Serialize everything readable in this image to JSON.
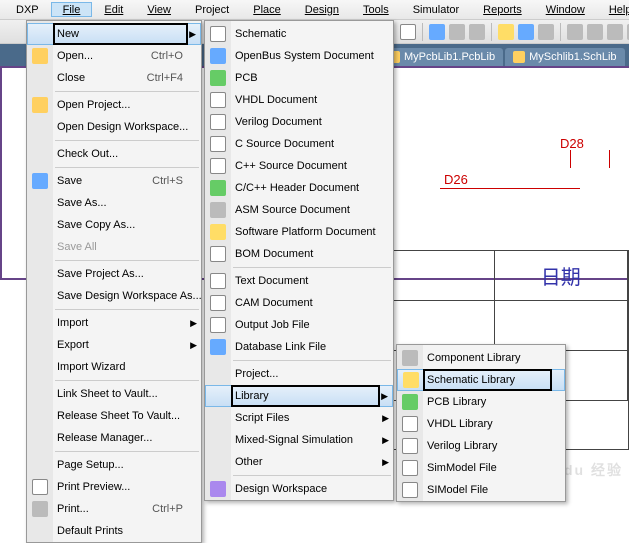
{
  "menubar": {
    "file": "File",
    "dxp": "DXP",
    "edit": "Edit",
    "view": "View",
    "project": "Project",
    "place": "Place",
    "design": "Design",
    "tools": "Tools",
    "simulator": "Simulator",
    "reports": "Reports",
    "window": "Window",
    "help": "Help"
  },
  "tabs": {
    "t1": "MyPcbLib1.PcbLib",
    "t2": "MySchlib1.SchLib"
  },
  "canvas": {
    "d28": "D28",
    "d26": "D26",
    "bigcell": "日期"
  },
  "file_menu": {
    "new": "New",
    "open": "Open...",
    "open_sc": "Ctrl+O",
    "close": "Close",
    "close_sc": "Ctrl+F4",
    "open_project": "Open Project...",
    "open_workspace": "Open Design Workspace...",
    "check_out": "Check Out...",
    "save": "Save",
    "save_sc": "Ctrl+S",
    "save_as": "Save As...",
    "save_copy": "Save Copy As...",
    "save_all": "Save All",
    "save_project_as": "Save Project As...",
    "save_workspace_as": "Save Design Workspace As...",
    "import": "Import",
    "export": "Export",
    "import_wizard": "Import Wizard",
    "link_vault": "Link Sheet to Vault...",
    "release_vault": "Release Sheet To Vault...",
    "release_manager": "Release Manager...",
    "page_setup": "Page Setup...",
    "print_preview": "Print Preview...",
    "print": "Print...",
    "print_sc": "Ctrl+P",
    "default_prints": "Default Prints"
  },
  "new_menu": {
    "schematic": "Schematic",
    "openbus": "OpenBus System Document",
    "pcb": "PCB",
    "vhdl": "VHDL Document",
    "verilog": "Verilog Document",
    "csrc": "C Source Document",
    "cppsrc": "C++ Source Document",
    "cpphdr": "C/C++ Header Document",
    "asm": "ASM Source Document",
    "swplat": "Software Platform Document",
    "bom": "BOM Document",
    "text": "Text Document",
    "cam": "CAM Document",
    "output": "Output Job File",
    "dblink": "Database Link File",
    "project": "Project...",
    "library": "Library",
    "script": "Script Files",
    "mixed": "Mixed-Signal Simulation",
    "other": "Other",
    "workspace": "Design Workspace"
  },
  "lib_menu": {
    "component": "Component Library",
    "schematic": "Schematic Library",
    "pcb": "PCB Library",
    "vhdl": "VHDL Library",
    "verilog": "Verilog Library",
    "simmodel": "SimModel File",
    "simodel": "SIModel File"
  }
}
